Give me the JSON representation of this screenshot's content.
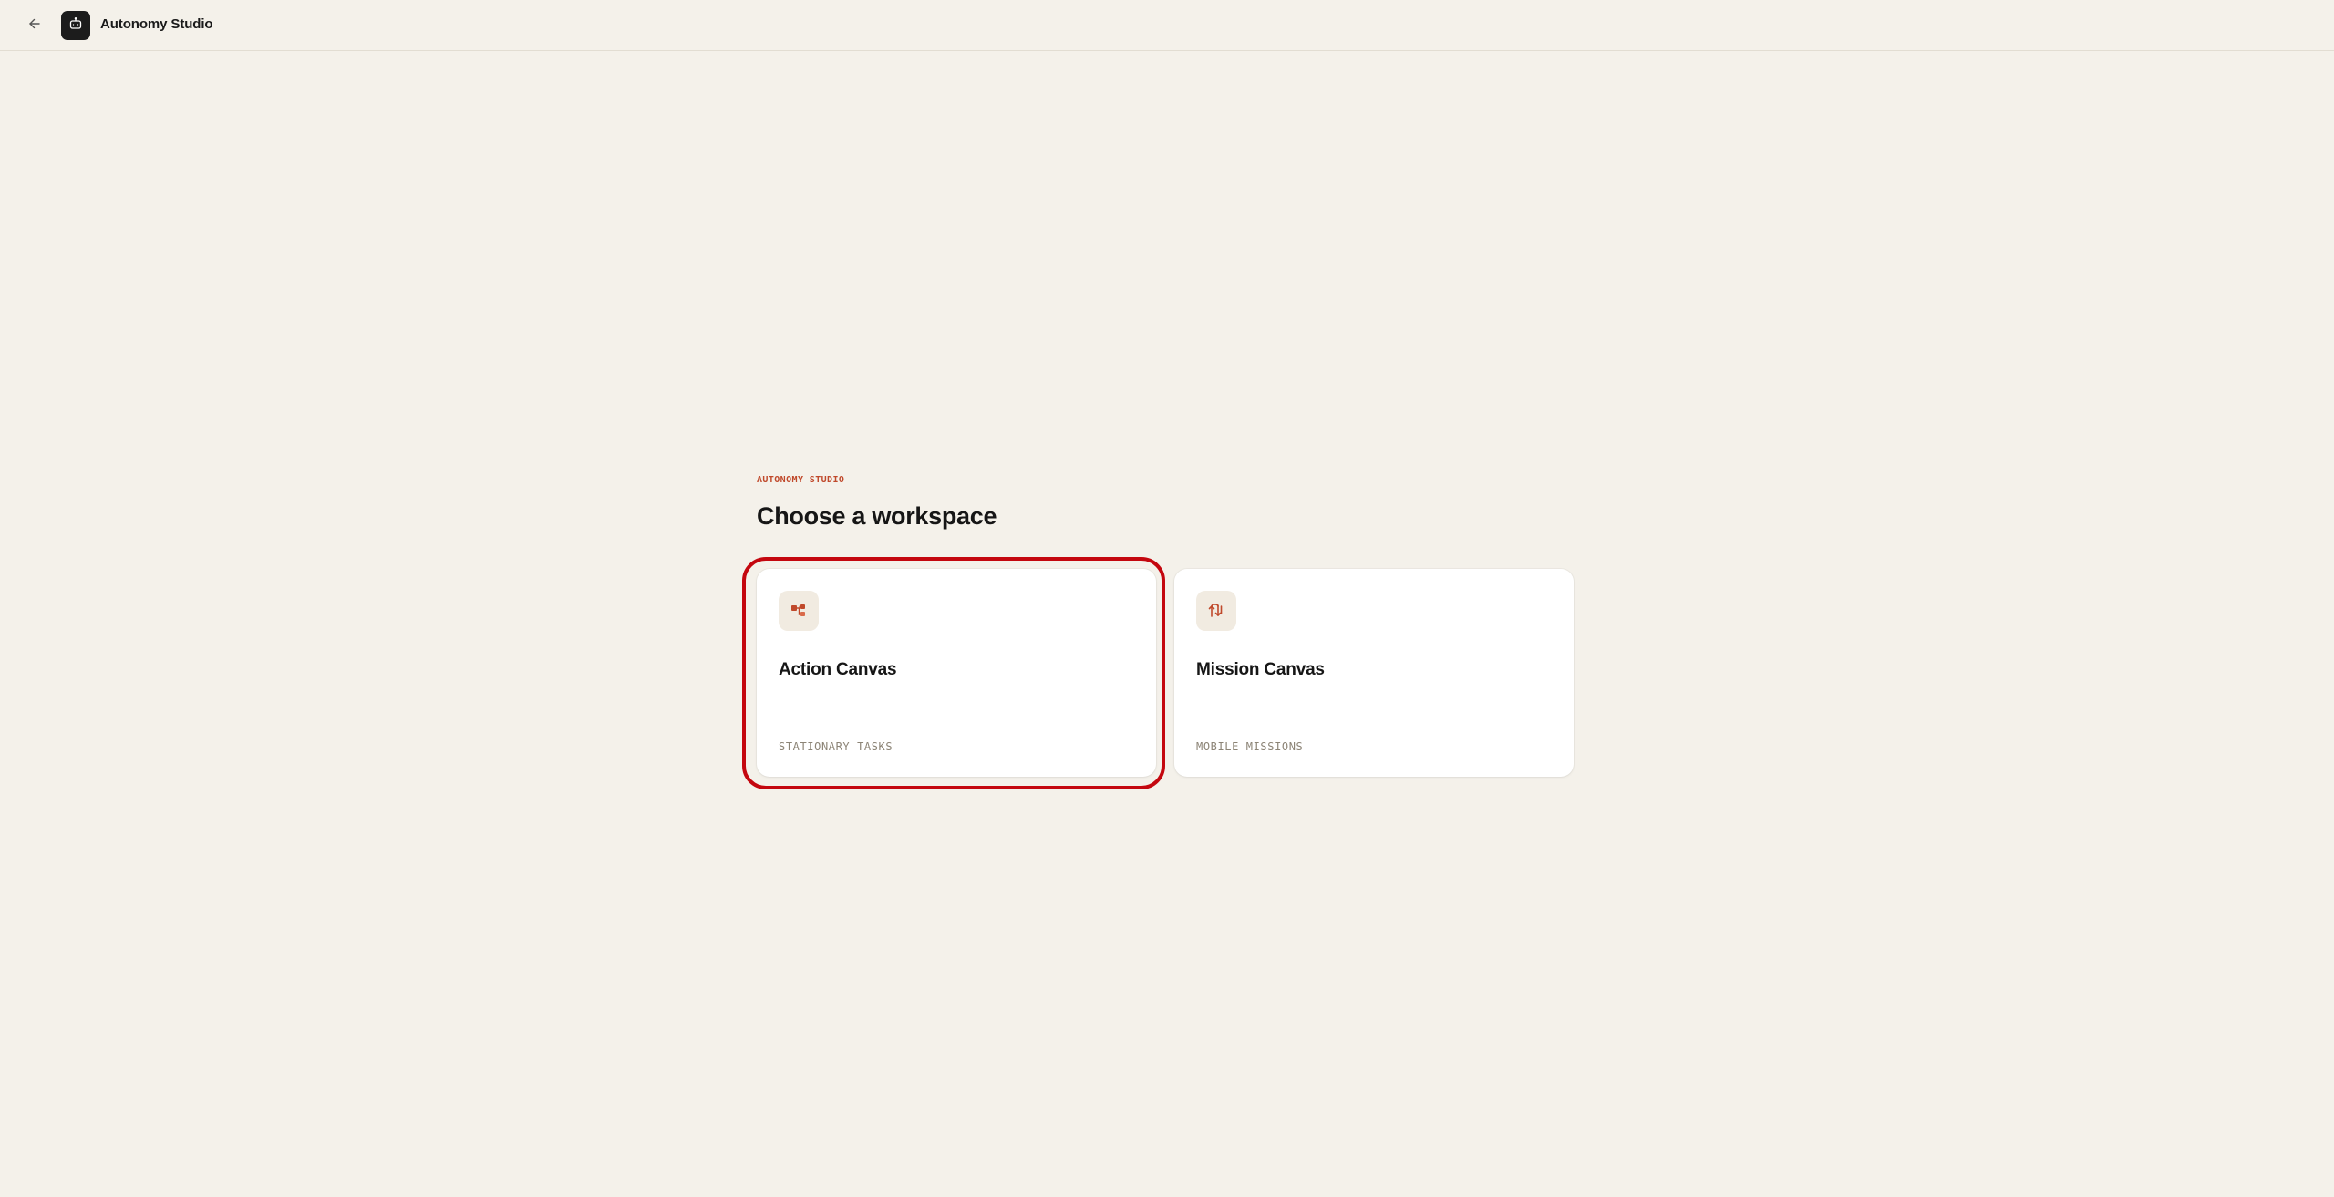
{
  "topbar": {
    "back_icon": "arrow-left-icon",
    "logo_icon": "robot-icon",
    "title": "Autonomy Studio"
  },
  "main": {
    "eyebrow": "AUTONOMY STUDIO",
    "heading": "Choose a workspace",
    "cards": [
      {
        "title": "Action Canvas",
        "subtitle": "STATIONARY TASKS",
        "icon": "flow-blocks-icon",
        "selected": true
      },
      {
        "title": "Mission Canvas",
        "subtitle": "MOBILE MISSIONS",
        "icon": "route-arrows-icon",
        "selected": false
      }
    ]
  },
  "colors": {
    "background": "#f4f1ea",
    "accent": "#c0492b",
    "selection_outline": "#c4070f",
    "card": "#ffffff",
    "icon_tile": "#f1ebe1"
  }
}
